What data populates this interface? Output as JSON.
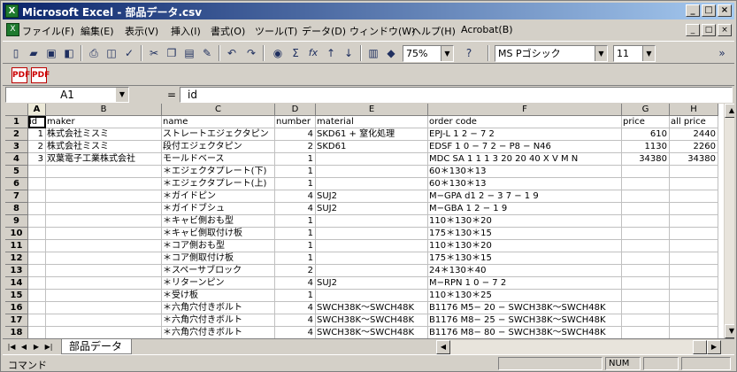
{
  "window": {
    "title": "Microsoft Excel - 部品データ.csv",
    "app_icon": "excel-icon"
  },
  "caption_buttons": [
    "_",
    "□",
    "×"
  ],
  "menu": [
    "ファイル(F)",
    "編集(E)",
    "表示(V)",
    "挿入(I)",
    "書式(O)",
    "ツール(T)",
    "データ(D)",
    "ウィンドウ(W)",
    "ヘルプ(H)",
    "Acrobat(B)"
  ],
  "toolbar": {
    "zoom": "75%",
    "font": "MS Pゴシック",
    "font_size": "11",
    "autosum_glyph": "Σ",
    "function_glyph": "fx"
  },
  "pdf_buttons": [
    "PDF",
    "PDF"
  ],
  "formula_bar": {
    "name_box": "A1",
    "eq": "=",
    "formula": "id"
  },
  "columns": [
    {
      "letter": "A",
      "width": 20
    },
    {
      "letter": "B",
      "width": 131
    },
    {
      "letter": "C",
      "width": 128
    },
    {
      "letter": "D",
      "width": 46
    },
    {
      "letter": "E",
      "width": 127
    },
    {
      "letter": "F",
      "width": 219
    },
    {
      "letter": "G",
      "width": 54
    },
    {
      "letter": "H",
      "width": 55
    }
  ],
  "rows": [
    {
      "n": "1",
      "cells": [
        "id",
        "maker",
        "name",
        "number",
        "material",
        "order code",
        "price",
        "all price"
      ]
    },
    {
      "n": "2",
      "cells": [
        "1",
        "株式会社ミスミ",
        "ストレートエジェクタピン",
        "4",
        "SKD61 + 窒化処理",
        "EPJ-L 1 2 − 7 2",
        "610",
        "2440"
      ]
    },
    {
      "n": "3",
      "cells": [
        "2",
        "株式会社ミスミ",
        "段付エジェクタピン",
        "2",
        "SKD61",
        "EDSF 1 0 − 7 2 − P8 − N46",
        "1130",
        "2260"
      ]
    },
    {
      "n": "4",
      "cells": [
        "3",
        "双葉電子工業株式会社",
        "モールドベース",
        "1",
        "",
        "MDC SA 1 1 1 3 20 20 40 X V M N",
        "34380",
        "34380"
      ]
    },
    {
      "n": "5",
      "cells": [
        "",
        "",
        "＊エジェクタプレート(下)",
        "1",
        "",
        "60＊130＊13",
        "",
        ""
      ]
    },
    {
      "n": "6",
      "cells": [
        "",
        "",
        "＊エジェクタプレート(上)",
        "1",
        "",
        "60＊130＊13",
        "",
        ""
      ]
    },
    {
      "n": "7",
      "cells": [
        "",
        "",
        "＊ガイドピン",
        "4",
        "SUJ2",
        "M−GPA d1 2 − 3 7 − 1 9",
        "",
        ""
      ]
    },
    {
      "n": "8",
      "cells": [
        "",
        "",
        "＊ガイドブシュ",
        "4",
        "SUJ2",
        "M−GBA 1 2 − 1 9",
        "",
        ""
      ]
    },
    {
      "n": "9",
      "cells": [
        "",
        "",
        "＊キャビ側おも型",
        "1",
        "",
        "110＊130＊20",
        "",
        ""
      ]
    },
    {
      "n": "10",
      "cells": [
        "",
        "",
        "＊キャビ側取付け板",
        "1",
        "",
        "175＊130＊15",
        "",
        ""
      ]
    },
    {
      "n": "11",
      "cells": [
        "",
        "",
        "＊コア側おも型",
        "1",
        "",
        "110＊130＊20",
        "",
        ""
      ]
    },
    {
      "n": "12",
      "cells": [
        "",
        "",
        "＊コア側取付け板",
        "1",
        "",
        "175＊130＊15",
        "",
        ""
      ]
    },
    {
      "n": "13",
      "cells": [
        "",
        "",
        "＊スペーサブロック",
        "2",
        "",
        "24＊130＊40",
        "",
        ""
      ]
    },
    {
      "n": "14",
      "cells": [
        "",
        "",
        "＊リターンピン",
        "4",
        "SUJ2",
        "M−RPN 1 0 − 7 2",
        "",
        ""
      ]
    },
    {
      "n": "15",
      "cells": [
        "",
        "",
        "＊受け板",
        "1",
        "",
        "110＊130＊25",
        "",
        ""
      ]
    },
    {
      "n": "16",
      "cells": [
        "",
        "",
        "＊六角穴付きボルト",
        "4",
        "SWCH38K〜SWCH48K",
        "B1176 M5− 20 − SWCH38K〜SWCH48K",
        "",
        ""
      ]
    },
    {
      "n": "17",
      "cells": [
        "",
        "",
        "＊六角穴付きボルト",
        "4",
        "SWCH38K〜SWCH48K",
        "B1176 M8− 25 − SWCH38K〜SWCH48K",
        "",
        ""
      ]
    },
    {
      "n": "18",
      "cells": [
        "",
        "",
        "＊六角穴付きボルト",
        "4",
        "SWCH38K〜SWCH48K",
        "B1176 M8− 80 − SWCH38K〜SWCH48K",
        "",
        ""
      ]
    }
  ],
  "sheet_tab": "部品データ",
  "status": {
    "mode": "コマンド",
    "num": "NUM"
  }
}
